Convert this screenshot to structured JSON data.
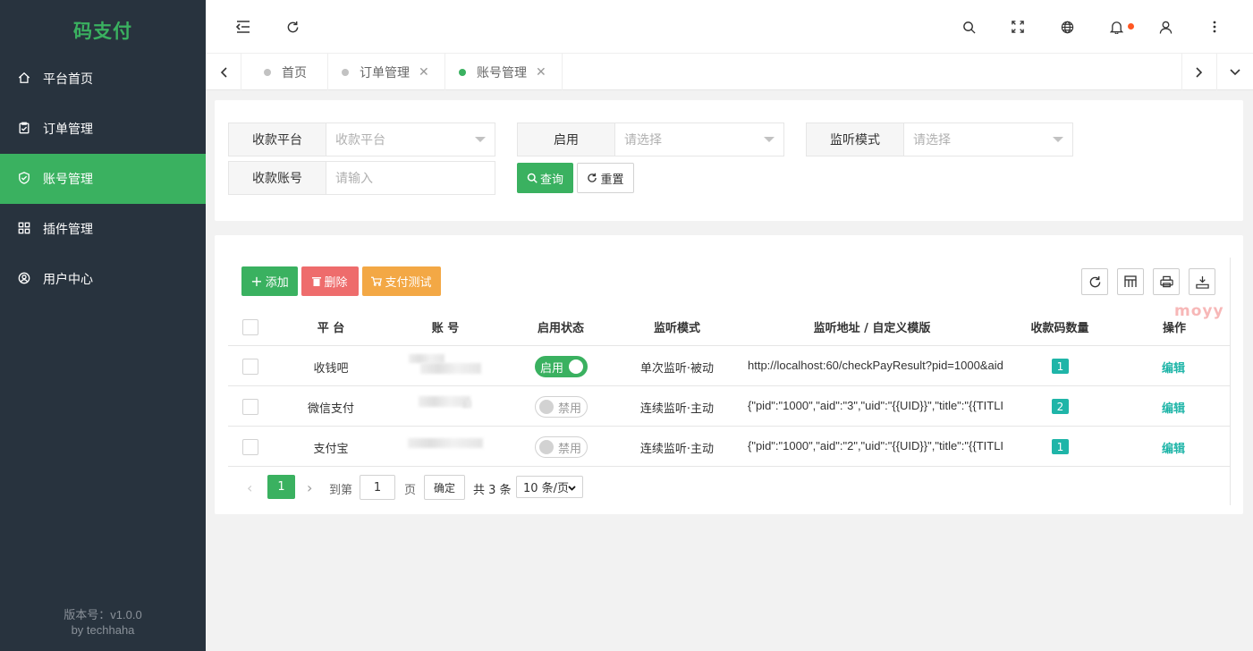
{
  "app": {
    "logo": "码支付",
    "version": "版本号：v1.0.0",
    "author": "by techhaha"
  },
  "sidebar": {
    "items": [
      {
        "label": "平台首页",
        "icon": "home-icon"
      },
      {
        "label": "订单管理",
        "icon": "clipboard-icon"
      },
      {
        "label": "账号管理",
        "icon": "shield-icon"
      },
      {
        "label": "插件管理",
        "icon": "grid-icon"
      },
      {
        "label": "用户中心",
        "icon": "user-circle-icon"
      }
    ],
    "active_index": 2
  },
  "tabs": [
    {
      "label": "首页",
      "closable": false
    },
    {
      "label": "订单管理",
      "closable": true
    },
    {
      "label": "账号管理",
      "closable": true,
      "active": true
    }
  ],
  "filters": {
    "platform": {
      "label": "收款平台",
      "placeholder": "收款平台"
    },
    "enabled": {
      "label": "启用",
      "placeholder": "请选择"
    },
    "mode": {
      "label": "监听模式",
      "placeholder": "请选择"
    },
    "account": {
      "label": "收款账号",
      "placeholder": "请输入"
    },
    "search_label": "查询",
    "reset_label": "重置"
  },
  "toolbar": {
    "add_label": "添加",
    "delete_label": "删除",
    "test_label": "支付测试"
  },
  "table": {
    "columns": [
      "平 台",
      "账 号",
      "启用状态",
      "监听模式",
      "监听地址 / 自定义模版",
      "收款码数量",
      "操作"
    ],
    "rows": [
      {
        "platform": "收钱吧",
        "enabled": true,
        "status_label": "启用",
        "mode": "单次监听·被动",
        "address": "http://localhost:60/checkPayResult?pid=1000&aid",
        "count": "1",
        "action": "编辑"
      },
      {
        "platform": "微信支付",
        "enabled": false,
        "status_label": "禁用",
        "mode": "连续监听·主动",
        "address": "{\"pid\":\"1000\",\"aid\":\"3\",\"uid\":\"{{UID}}\",\"title\":\"{{TITLI",
        "count": "2",
        "action": "编辑"
      },
      {
        "platform": "支付宝",
        "enabled": false,
        "status_label": "禁用",
        "mode": "连续监听·主动",
        "address": "{\"pid\":\"1000\",\"aid\":\"2\",\"uid\":\"{{UID}}\",\"title\":\"{{TITLI",
        "count": "1",
        "action": "编辑"
      }
    ]
  },
  "pagination": {
    "current": "1",
    "goto_label": "到第",
    "goto_value": "1",
    "page_label": "页",
    "confirm_label": "确定",
    "total_label": "共 3 条",
    "size_label": "10 条/页"
  },
  "watermark": "moyy",
  "colors": {
    "brand": "#3ab160",
    "sidebar": "#28333e",
    "teal": "#1fb5a8",
    "danger": "#ee6c6c",
    "warning": "#f3a845",
    "notify_dot": "#ff5722"
  }
}
